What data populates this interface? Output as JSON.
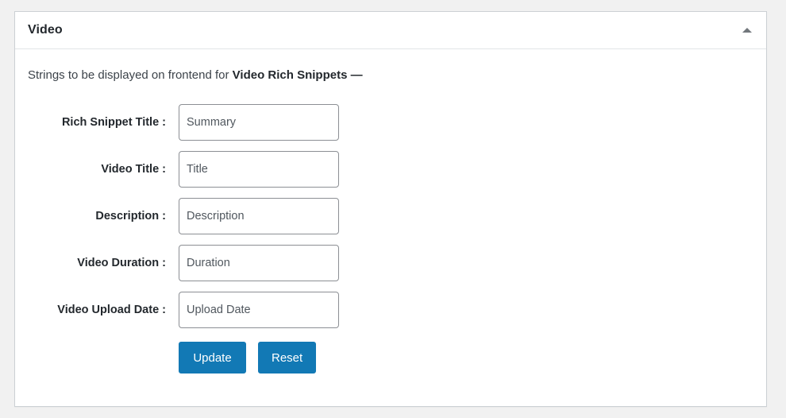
{
  "panel": {
    "title": "Video",
    "toggle_icon": "caret-up-icon",
    "intro_prefix": "Strings to be displayed on frontend for ",
    "intro_emphasis": "Video Rich Snippets —"
  },
  "form": {
    "fields": [
      {
        "label": "Rich Snippet Title :",
        "value": "Summary",
        "placeholder": "Summary",
        "name": "rich-snippet-title"
      },
      {
        "label": "Video Title :",
        "value": "Title",
        "placeholder": "Title",
        "name": "video-title"
      },
      {
        "label": "Description :",
        "value": "Description",
        "placeholder": "Description",
        "name": "description"
      },
      {
        "label": "Video Duration :",
        "value": "Duration",
        "placeholder": "Duration",
        "name": "video-duration"
      },
      {
        "label": "Video Upload Date :",
        "value": "Upload Date",
        "placeholder": "Upload Date",
        "name": "video-upload-date"
      }
    ],
    "buttons": {
      "update": "Update",
      "reset": "Reset"
    }
  },
  "colors": {
    "accent": "#1279b5",
    "page_background": "#f1f1f1",
    "panel_border": "#ccd0d4",
    "label_text": "#23282d",
    "input_text": "#50575e"
  }
}
